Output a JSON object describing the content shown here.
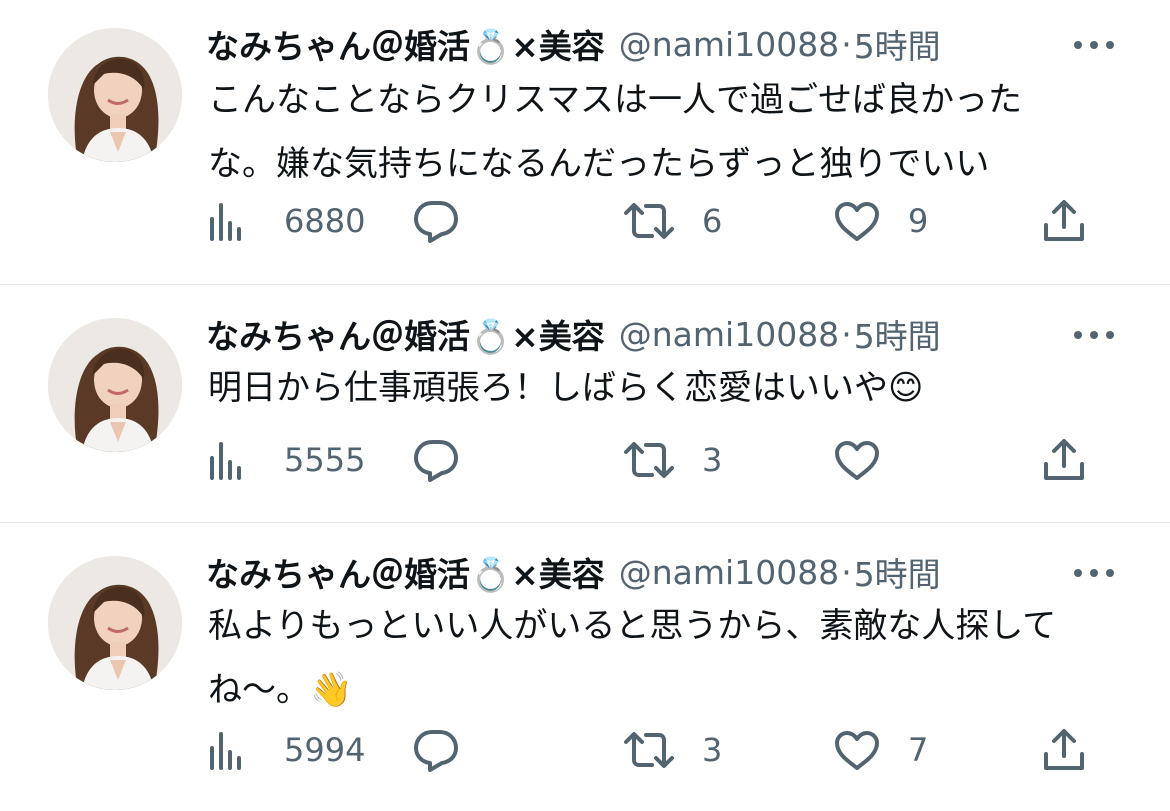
{
  "icons": {
    "avatar": "profile-photo",
    "name_emoji": "ring-emoji",
    "more": "more-icon",
    "views": "views-icon",
    "reply": "reply-icon",
    "retweet": "retweet-icon",
    "like": "heart-icon",
    "share": "share-icon"
  },
  "colors": {
    "text": "#0f1419",
    "secondary": "#536471",
    "divider": "#e3e6ea"
  },
  "tweets": [
    {
      "author": {
        "name_prefix": "なみちゃん＠婚活",
        "name_emoji": "💍",
        "name_suffix": "×美容",
        "handle": "@nami10088",
        "separator": "·",
        "time": "5時間"
      },
      "text_lines": [
        "こんなことならクリスマスは一人で過ごせば良かった",
        "な。嫌な気持ちになるんだったらずっと独りでいい"
      ],
      "stats": {
        "views": "6880",
        "replies": "",
        "retweets": "6",
        "likes": "9"
      }
    },
    {
      "author": {
        "name_prefix": "なみちゃん＠婚活",
        "name_emoji": "💍",
        "name_suffix": "×美容",
        "handle": "@nami10088",
        "separator": "·",
        "time": "5時間"
      },
      "text_lines": [
        "明日から仕事頑張ろ！しばらく恋愛はいいや😊"
      ],
      "stats": {
        "views": "5555",
        "replies": "",
        "retweets": "3",
        "likes": ""
      }
    },
    {
      "author": {
        "name_prefix": "なみちゃん＠婚活",
        "name_emoji": "💍",
        "name_suffix": "×美容",
        "handle": "@nami10088",
        "separator": "·",
        "time": "5時間"
      },
      "text_lines": [
        "私よりもっといい人がいると思うから、素敵な人探して",
        "ね〜。👋"
      ],
      "stats": {
        "views": "5994",
        "replies": "",
        "retweets": "3",
        "likes": "7"
      }
    }
  ]
}
